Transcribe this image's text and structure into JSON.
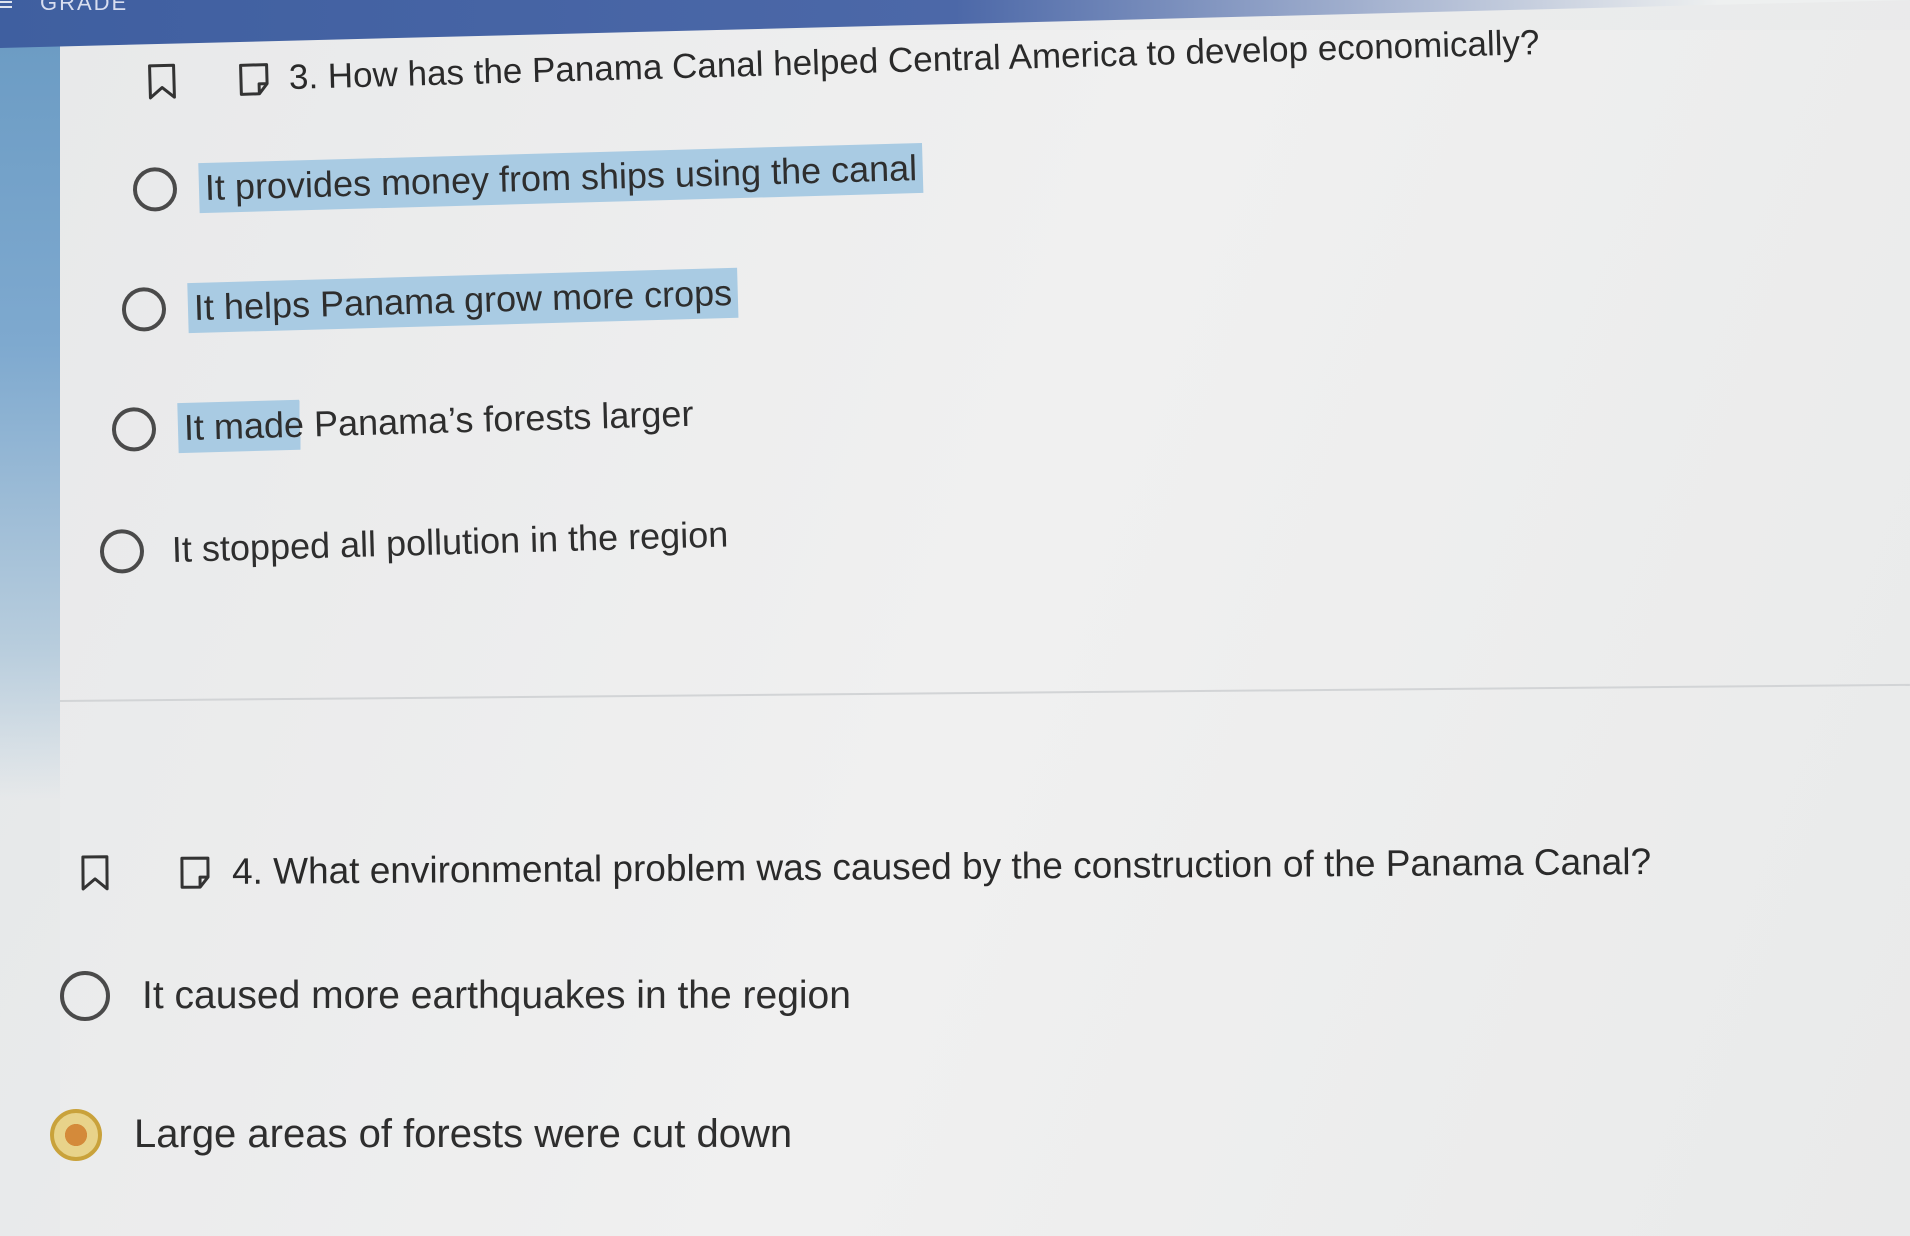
{
  "header": {
    "title": "GRADE"
  },
  "questions": [
    {
      "text": "3. How has the Panama Canal helped Central America to develop economically?",
      "options": [
        {
          "label": "It provides money from ships using the canal"
        },
        {
          "label": "It helps Panama grow more crops"
        },
        {
          "label": "It made Panama’s forests larger"
        },
        {
          "label": "It stopped all pollution in the region"
        }
      ]
    },
    {
      "text": "4. What environmental problem was caused by the construction of the Panama Canal?",
      "options": [
        {
          "label": "It caused more earthquakes in the region"
        },
        {
          "label": "Large areas of forests were cut down",
          "selected": true
        }
      ]
    }
  ],
  "colors": {
    "highlight": "#a9cbe3",
    "selected_radio": "#d48a3a",
    "header_bar": "#3f5fa0"
  }
}
